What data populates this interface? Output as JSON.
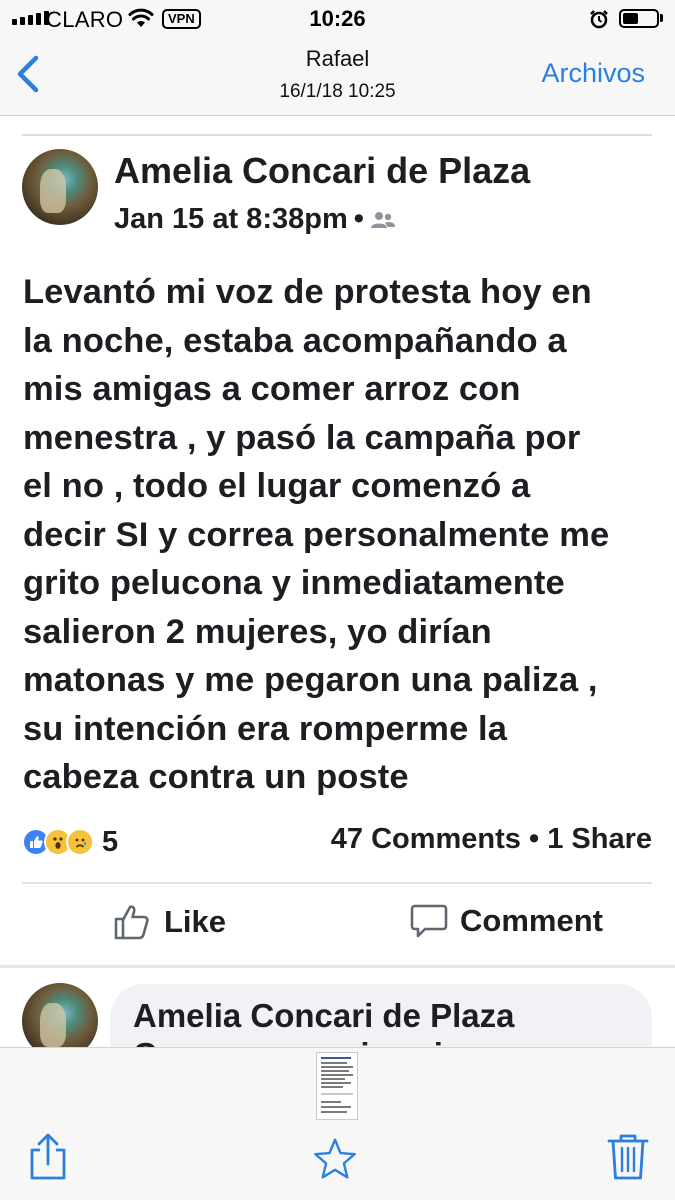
{
  "status_bar": {
    "carrier": "CLARO",
    "vpn": "VPN",
    "time": "10:26",
    "icons": [
      "signal-icon",
      "wifi-icon",
      "alarm-icon",
      "battery-icon"
    ],
    "battery_level": 0.48
  },
  "nav": {
    "back_icon": "chevron-left-icon",
    "title": "Rafael",
    "subtitle": "16/1/18 10:25",
    "right_action": "Archivos",
    "accent_color": "#2a7fe0"
  },
  "post": {
    "author": "Amelia Concari de Plaza",
    "timestamp": "Jan 15 at 8:38pm",
    "separator": "•",
    "audience_icon": "friends-icon",
    "body_lines": [
      "Levantó mi voz de protesta hoy en",
      "la noche, estaba acompañando a",
      "mis amigas a comer arroz con",
      "menestra , y pasó la campaña por",
      "el no , todo el lugar comenzó a",
      "decir SI y correa personalmente me",
      "grito pelucona y inmediatamente",
      "salieron 2 mujeres, yo dirían",
      "matonas y me pegaron una paliza ,",
      "su intención era romperme la",
      "cabeza contra un poste"
    ],
    "reactions": [
      "like-reaction-icon",
      "wow-reaction-icon",
      "sad-reaction-icon"
    ],
    "reaction_count": "5",
    "stats": "47 Comments • 1 Share",
    "actions": {
      "like": "Like",
      "comment": "Comment"
    }
  },
  "comment": {
    "author": "Amelia Concari de Plaza",
    "text": "Conocemos mi vecino"
  },
  "toolbar": {
    "icons": [
      "share-icon",
      "star-icon",
      "trash-icon"
    ]
  }
}
